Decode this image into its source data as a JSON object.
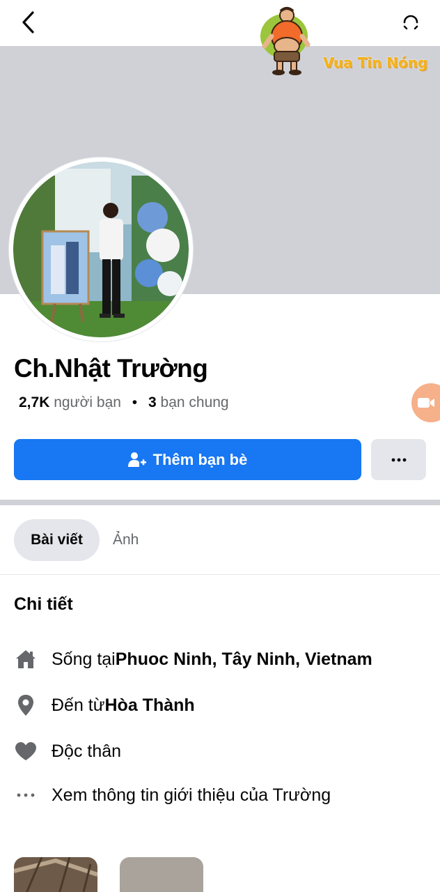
{
  "topbar": {
    "back_icon": "chevron-left-icon",
    "sync_icon": "refresh-icon"
  },
  "watermark": {
    "text": "Vua Tin Nóng",
    "mascot_icon": "cartoon-mascot-icon"
  },
  "profile": {
    "name": "Ch.Nhật Trường",
    "friends_count": "2,7K",
    "friends_label": "người bạn",
    "separator": "•",
    "mutual_count": "3",
    "mutual_label": "bạn chung"
  },
  "actions": {
    "add_friend_label": "Thêm bạn bè",
    "add_friend_icon": "add-person-icon",
    "more_icon": "more-horizontal-icon",
    "video_icon": "video-camera-icon"
  },
  "tabs": [
    {
      "label": "Bài viết",
      "selected": true
    },
    {
      "label": "Ảnh",
      "selected": false
    }
  ],
  "details": {
    "title": "Chi tiết",
    "lives_in_prefix": "Sống tại ",
    "lives_in_value": "Phuoc Ninh, Tây Ninh, Vietnam",
    "from_prefix": "Đến từ ",
    "from_value": "Hòa Thành",
    "relationship": "Độc thân",
    "see_more": "Xem thông tin giới thiệu của Trường"
  },
  "colors": {
    "primary": "#1877f2",
    "cover": "#cfd1d6",
    "secondary_button": "#e4e6eb",
    "muted_text": "#65676b",
    "watermark": "#f4b21a"
  }
}
